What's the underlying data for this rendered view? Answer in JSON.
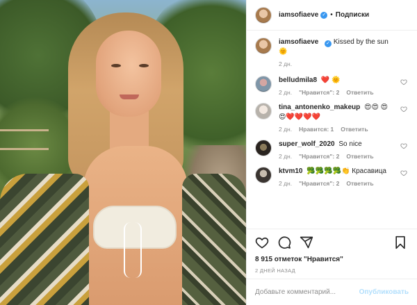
{
  "post": {
    "author": "iamsofiaeve",
    "follow_label": "Подписки",
    "caption": "Kissed by the sun",
    "caption_emoji": "🌞",
    "caption_time": "2 дн."
  },
  "comments": [
    {
      "user": "belludmila8",
      "text": "❤️ 🌞",
      "time": "2 дн.",
      "likes": "\"Нравится\": 2",
      "reply": "Ответить"
    },
    {
      "user": "tina_antonenko_makeup",
      "text": "😍😍 😍😍❤️❤️❤️❤️",
      "time": "2 дн.",
      "likes": "Нравится: 1",
      "reply": "Ответить"
    },
    {
      "user": "super_wolf_2020",
      "text": "So nice",
      "time": "2 дн.",
      "likes": "\"Нравится\": 2",
      "reply": "Ответить"
    },
    {
      "user": "ktvm10",
      "text": "🥦🥦🥦🥦👏 Красавица",
      "time": "2 дн.",
      "likes": "\"Нравится\": 2",
      "reply": "Ответить"
    }
  ],
  "actions": {
    "likes_text": "8 915 отметок \"Нравится\"",
    "posted_ago": "2 ДНЕЙ НАЗАД"
  },
  "add_comment": {
    "placeholder": "Добавьте комментарий...",
    "publish_label": "Опубликовать"
  },
  "icons": [
    "heart-icon",
    "comment-icon",
    "share-icon",
    "bookmark-icon",
    "verified-icon"
  ],
  "colors": {
    "verified": "#3897f0",
    "heart_red": "#ed4956",
    "publish_disabled": "#b2dffc",
    "muted": "#8e8e8e"
  }
}
